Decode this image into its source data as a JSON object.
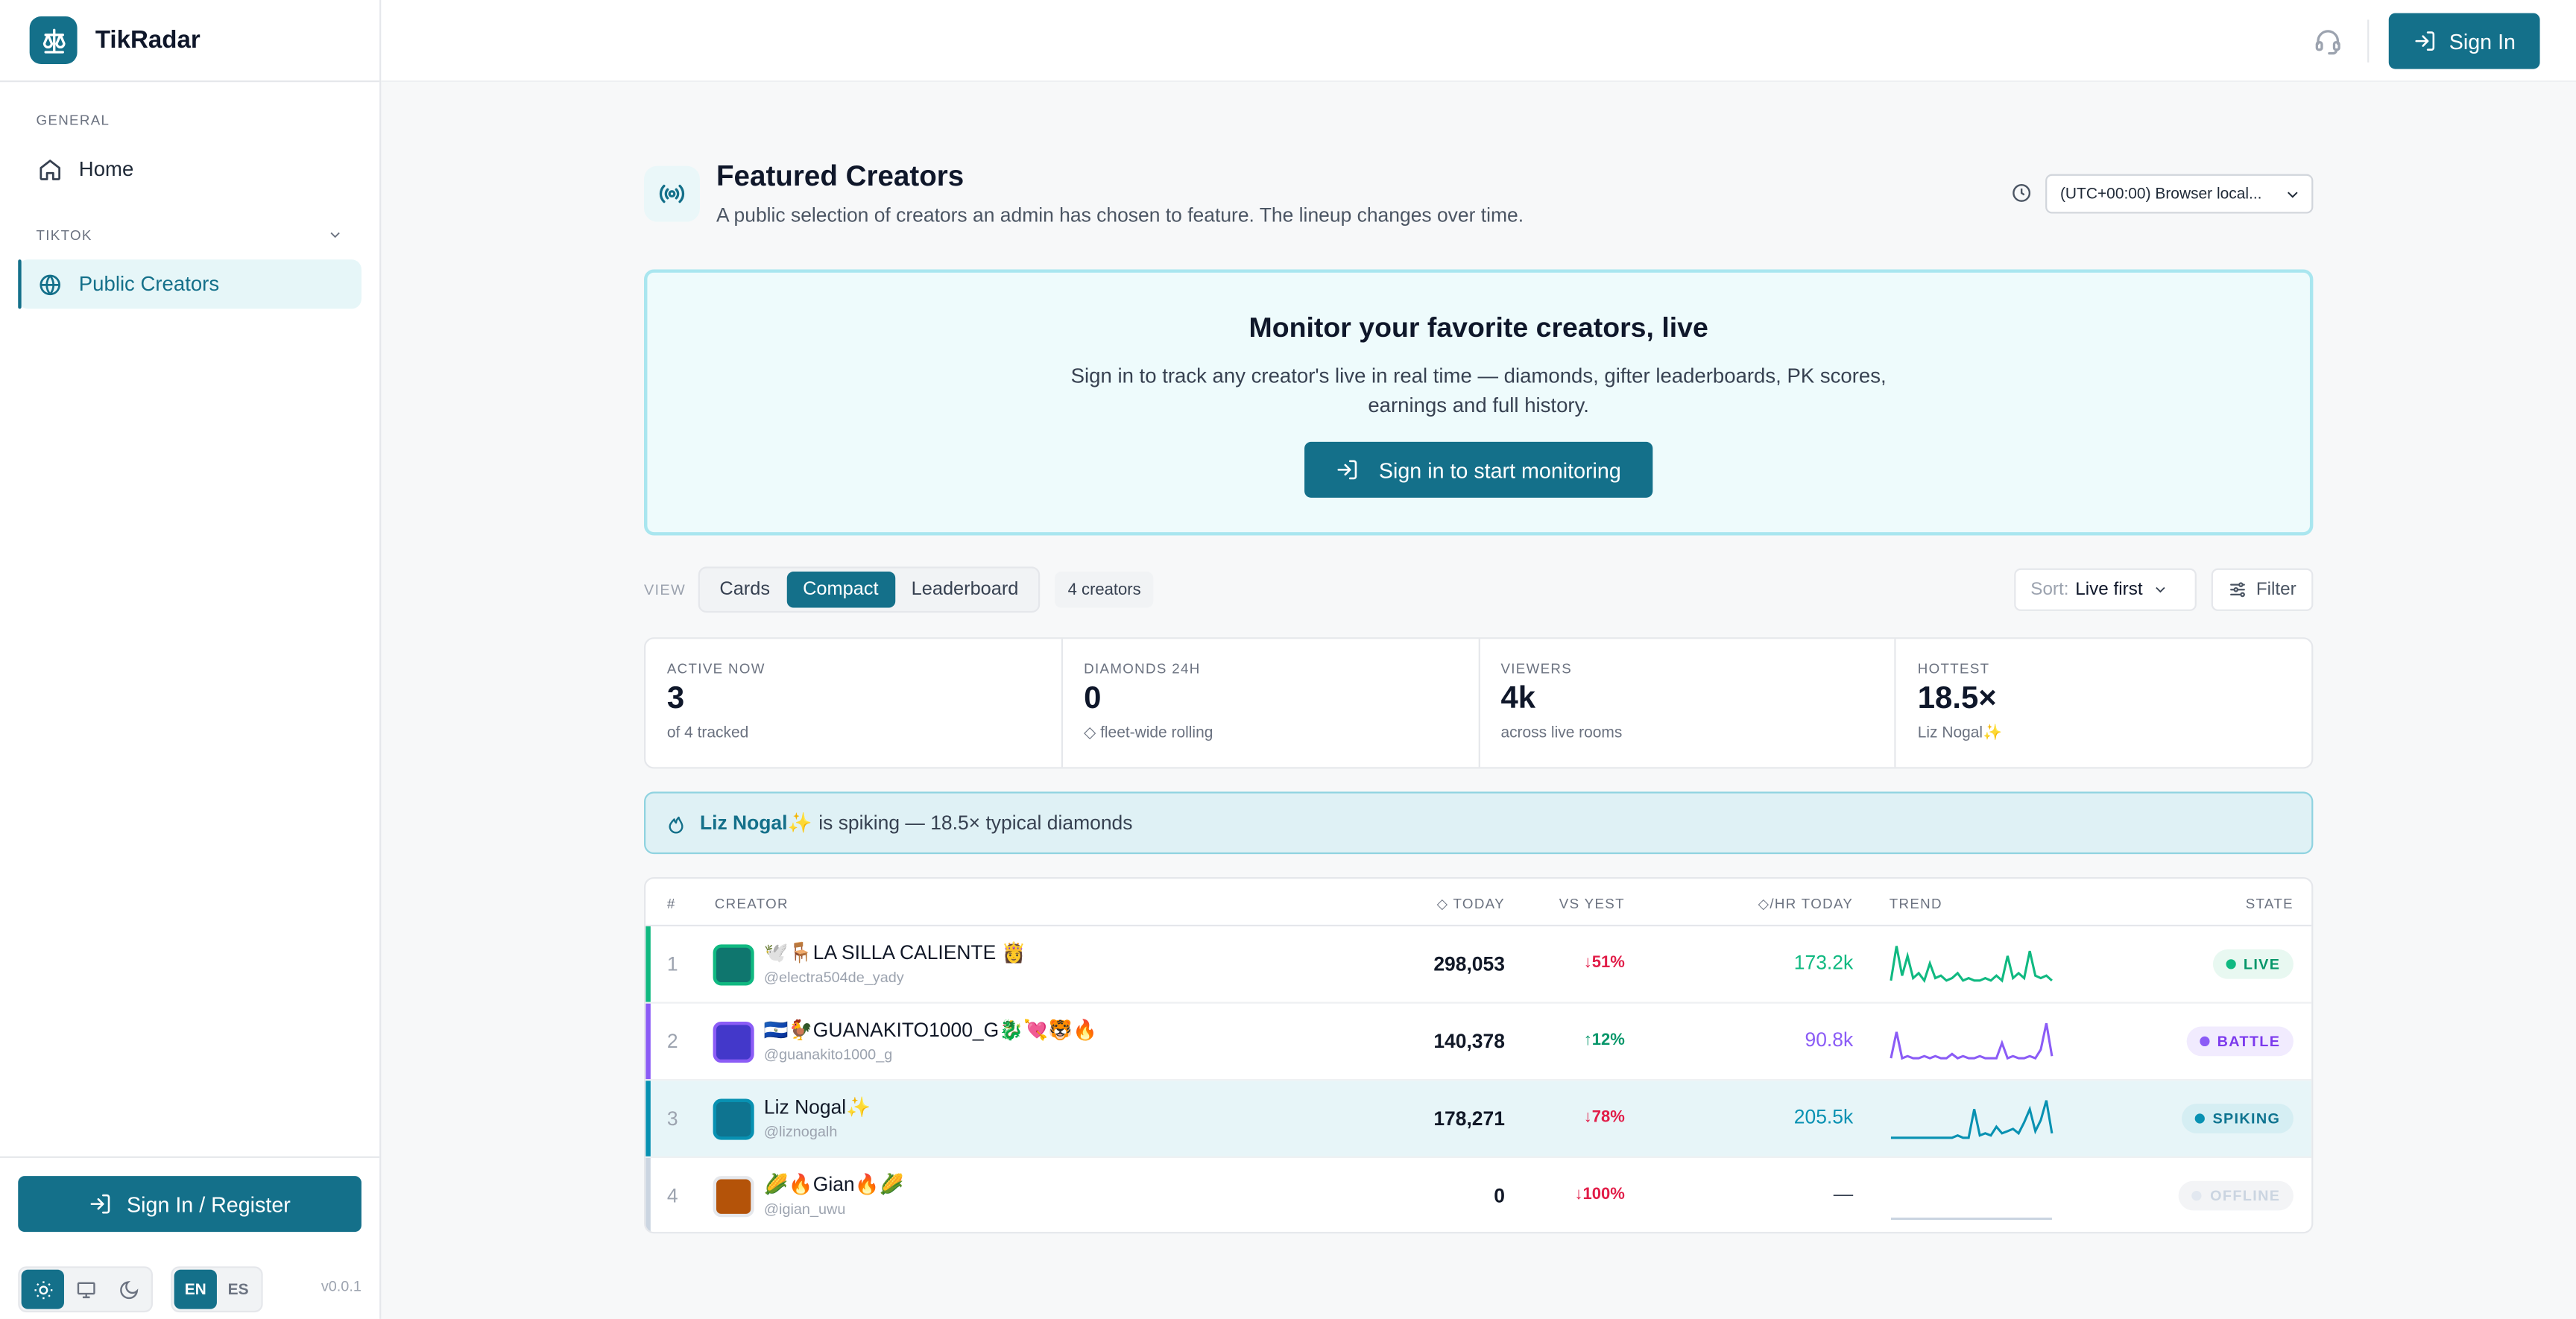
{
  "app": {
    "name": "TikRadar",
    "version": "v0.0.1"
  },
  "sidebar": {
    "section_general": "GENERAL",
    "home": "Home",
    "section_tiktok": "TIKTOK",
    "public_creators": "Public Creators",
    "signin_register": "Sign In / Register",
    "lang_en": "EN",
    "lang_es": "ES"
  },
  "topbar": {
    "sign_in": "Sign In"
  },
  "header": {
    "title": "Featured Creators",
    "subtitle": "A public selection of creators an admin has chosen to feature. The lineup changes over time.",
    "timezone": "(UTC+00:00) Browser local..."
  },
  "promo": {
    "title": "Monitor your favorite creators, live",
    "text": "Sign in to track any creator's live in real time — diamonds, gifter leaderboards, PK scores, earnings and full history.",
    "button": "Sign in to start monitoring"
  },
  "viewbar": {
    "label": "VIEW",
    "views": [
      "Cards",
      "Compact",
      "Leaderboard"
    ],
    "active_view": "Compact",
    "count": "4 creators",
    "sort_key": "Sort:",
    "sort_value": "Live first",
    "filter": "Filter"
  },
  "stats": [
    {
      "label": "ACTIVE NOW",
      "value": "3",
      "sub": "of 4 tracked"
    },
    {
      "label": "DIAMONDS 24H",
      "value": "0",
      "sub": "◇ fleet-wide rolling"
    },
    {
      "label": "VIEWERS",
      "value": "4k",
      "sub": "across live rooms"
    },
    {
      "label": "HOTTEST",
      "value": "18.5×",
      "sub": "Liz Nogal✨"
    }
  ],
  "alert": {
    "name": "Liz Nogal✨",
    "text": "is spiking — 18.5× typical diamonds"
  },
  "table": {
    "headers": {
      "rank": "#",
      "creator": "CREATOR",
      "today": "◇ TODAY",
      "vs": "VS YEST",
      "hr": "◇/HR TODAY",
      "trend": "TREND",
      "state": "STATE"
    },
    "rows": [
      {
        "rank": "1",
        "name": "🕊️🪑LA SILLA CALIENTE 👸",
        "handle": "@electra504de_yady",
        "today": "298,053",
        "vs": "↓51%",
        "hr": "173.2k",
        "state": "LIVE",
        "color": "#10b981",
        "trend": [
          2,
          16,
          4,
          12,
          3,
          5,
          2,
          9,
          3,
          4,
          2,
          3,
          5,
          2,
          3,
          2,
          2,
          3,
          2,
          4,
          2,
          12,
          3,
          5,
          3,
          14,
          4,
          3,
          4,
          2
        ]
      },
      {
        "rank": "2",
        "name": "🇸🇻🐓GUANAKITO1000_G🐉💘🐯🔥",
        "handle": "@guanakito1000_g",
        "today": "140,378",
        "vs": "↑12%",
        "hr": "90.8k",
        "state": "BATTLE",
        "color": "#8b5cf6",
        "trend": [
          2,
          14,
          2,
          3,
          2,
          2,
          3,
          2,
          3,
          2,
          2,
          4,
          2,
          3,
          2,
          2,
          3,
          2,
          2,
          2,
          9,
          2,
          3,
          2,
          2,
          3,
          2,
          6,
          18,
          3
        ]
      },
      {
        "rank": "3",
        "name": "Liz Nogal✨",
        "handle": "@liznogalh",
        "today": "178,271",
        "vs": "↓78%",
        "hr": "205.5k",
        "state": "SPIKING",
        "color": "#0891b2",
        "trend": [
          1,
          1,
          1,
          1,
          1,
          1,
          1,
          1,
          1,
          1,
          1,
          1,
          2,
          1,
          1,
          14,
          2,
          3,
          2,
          6,
          3,
          4,
          5,
          3,
          8,
          14,
          4,
          9,
          18,
          3
        ]
      },
      {
        "rank": "4",
        "name": "🌽🔥Gian🔥🌽",
        "handle": "@igian_uwu",
        "today": "0",
        "vs": "↓100%",
        "hr": "—",
        "state": "OFFLINE",
        "color": "#cbd5e1",
        "trend": []
      }
    ]
  }
}
